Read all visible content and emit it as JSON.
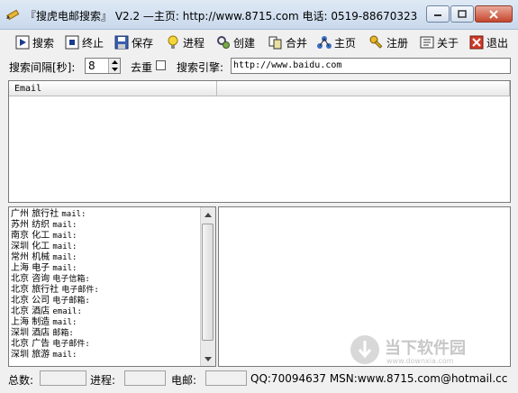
{
  "window": {
    "title": "『搜虎电邮搜索』 V2.2  —主页: http://www.8715.com 电话: 0519-88670323",
    "min_icon": "minimize-icon",
    "max_icon": "maximize-icon",
    "close_icon": "close-icon"
  },
  "toolbar": [
    {
      "label": "搜索",
      "icon": "play-icon"
    },
    {
      "label": "终止",
      "icon": "stop-icon"
    },
    {
      "label": "保存",
      "icon": "save-icon"
    },
    {
      "label": "进程",
      "icon": "lightbulb-icon"
    },
    {
      "label": "创建",
      "icon": "gear-create-icon"
    },
    {
      "label": "合并",
      "icon": "merge-icon"
    },
    {
      "label": "主页",
      "icon": "home-network-icon"
    },
    {
      "label": "注册",
      "icon": "key-icon"
    },
    {
      "label": "关于",
      "icon": "about-icon"
    },
    {
      "label": "退出",
      "icon": "exit-icon"
    }
  ],
  "options": {
    "interval_label": "搜索间隔[秒]:",
    "interval_value": "8",
    "dedupe_label": "去重",
    "dedupe_checked": false,
    "engine_label": "搜索引擎:",
    "engine_value": "http://www.baidu.com"
  },
  "email_table": {
    "columns": [
      "Email",
      ""
    ]
  },
  "keywords": [
    {
      "city": "广州",
      "type": "旅行社",
      "kind": "mail:"
    },
    {
      "city": "苏州",
      "type": "纺织",
      "kind": "mail:"
    },
    {
      "city": "南京",
      "type": "化工",
      "kind": "mail:"
    },
    {
      "city": "深圳",
      "type": "化工",
      "kind": "mail:"
    },
    {
      "city": "常州",
      "type": "机械",
      "kind": "mail:"
    },
    {
      "city": "上海",
      "type": "电子",
      "kind": "mail:"
    },
    {
      "city": "北京",
      "type": "咨询",
      "kind": "电子信箱:"
    },
    {
      "city": "北京",
      "type": "旅行社",
      "kind": "电子邮件:"
    },
    {
      "city": "北京",
      "type": "公司",
      "kind": "电子邮箱:"
    },
    {
      "city": "北京",
      "type": "酒店",
      "kind": "email:"
    },
    {
      "city": "上海",
      "type": "制造",
      "kind": "mail:"
    },
    {
      "city": "深圳",
      "type": "酒店",
      "kind": "邮箱:"
    },
    {
      "city": "北京",
      "type": "广告",
      "kind": "电子邮件:"
    },
    {
      "city": "深圳",
      "type": "旅游",
      "kind": "mail:"
    }
  ],
  "watermark": {
    "main": "当下软件园",
    "sub": "www.downxia.com"
  },
  "status": {
    "total_label": "总数:",
    "total_value": "",
    "progress_label": "进程:",
    "progress_value": "",
    "email_label": "电邮:",
    "email_value": "",
    "contact": "QQ:70094637 MSN:www.8715.com@hotmail.cc"
  },
  "colors": {
    "title_bg": "#c9d9ec",
    "close_btn": "#c6452c",
    "panel_border": "#7a7a7a"
  }
}
